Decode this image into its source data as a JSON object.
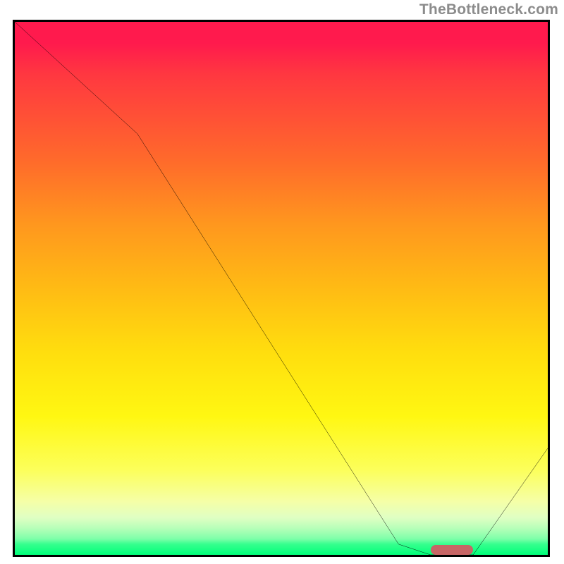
{
  "attribution": "TheBottleneck.com",
  "chart_data": {
    "type": "line",
    "title": "",
    "xlabel": "",
    "ylabel": "",
    "xlim": [
      0,
      100
    ],
    "ylim": [
      0,
      100
    ],
    "series": [
      {
        "name": "curve",
        "x": [
          0,
          23,
          72,
          78,
          86,
          100
        ],
        "values": [
          100,
          79,
          2,
          0,
          0,
          20
        ]
      }
    ],
    "marker": {
      "x_start": 78,
      "x_end": 86,
      "y": 0
    },
    "colors": {
      "top": "#ff1a4d",
      "mid": "#ffde0e",
      "bottom": "#00ff7a",
      "marker": "#c76666",
      "curve": "#000000"
    }
  }
}
